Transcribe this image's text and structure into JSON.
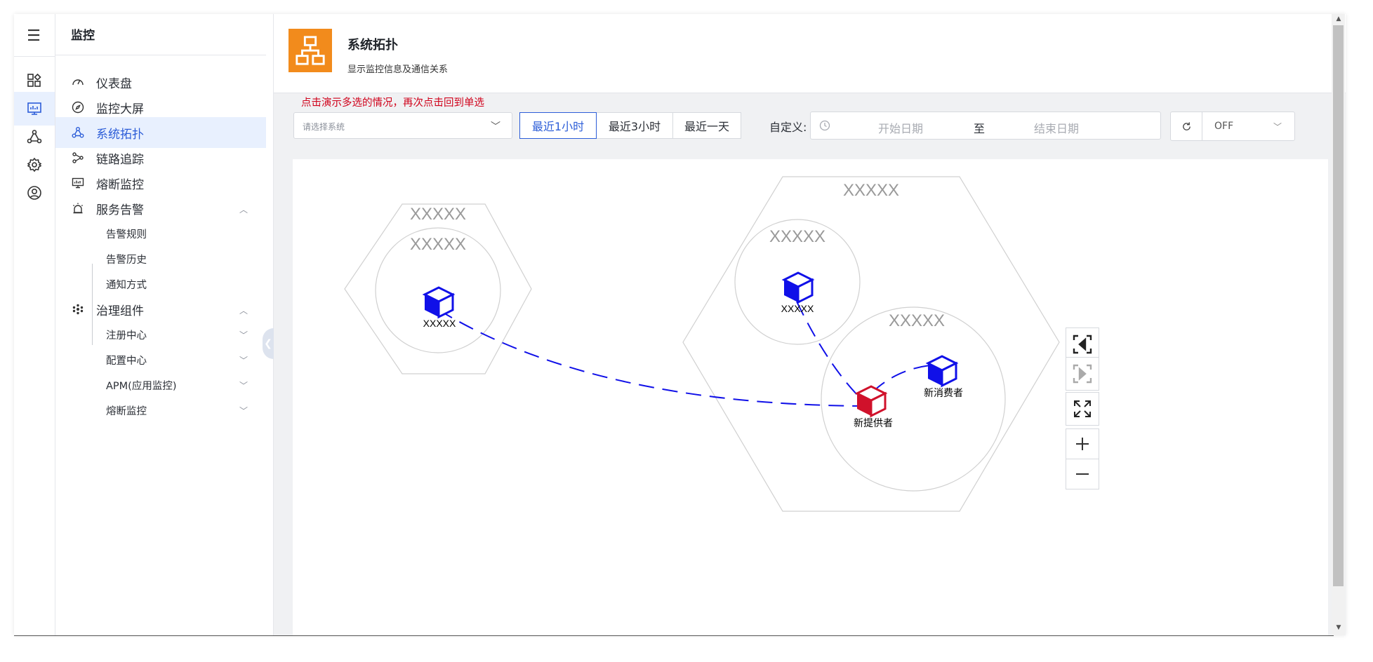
{
  "sidebar": {
    "section_title": "监控",
    "items": [
      {
        "label": "仪表盘",
        "icon": "dashboard-gauge-icon"
      },
      {
        "label": "监控大屏",
        "icon": "compass-icon"
      },
      {
        "label": "系统拓扑",
        "icon": "topology-icon",
        "active": true
      },
      {
        "label": "链路追踪",
        "icon": "trace-link-icon"
      },
      {
        "label": "熔断监控",
        "icon": "monitor-screen-icon"
      },
      {
        "label": "服务告警",
        "icon": "alarm-icon",
        "expanded": true
      },
      {
        "label": "治理组件",
        "icon": "components-cluster-icon",
        "expanded": true
      }
    ],
    "alarm_children": [
      "告警规则",
      "告警历史",
      "通知方式"
    ],
    "governance_children": [
      "注册中心",
      "配置中心",
      "APM(应用监控)",
      "熔断监控"
    ]
  },
  "header": {
    "title": "系统拓扑",
    "subtitle": "显示监控信息及通信关系"
  },
  "toolbar": {
    "hint": "点击演示多选的情况，再次点击回到单选",
    "system_placeholder": "请选择系统",
    "ranges": [
      "最近1小时",
      "最近3小时",
      "最近一天"
    ],
    "active_range": "最近1小时",
    "custom_label": "自定义:",
    "start_placeholder": "开始日期",
    "range_separator": "至",
    "end_placeholder": "结束日期",
    "refresh_value": "OFF"
  },
  "topology": {
    "left_group": {
      "hexagon_label": "XXXXX",
      "circle_label": "XXXXX",
      "node_label": "XXXXX"
    },
    "right_group": {
      "hexagon_label": "XXXXX",
      "upper_circle_label": "XXXXX",
      "upper_node_label": "XXXXX",
      "lower_circle_label": "XXXXX",
      "provider_label": "新提供者",
      "consumer_label": "新消费者"
    },
    "colors": {
      "service": "#1010e8",
      "provider": "#d0112b",
      "outline": "#d0d0d0",
      "label": "#999999"
    }
  },
  "colors": {
    "accent": "#2c5dd8",
    "header_icon_bg": "#f28b1c",
    "hint": "#d0021b",
    "active_bg": "#e8f0fe"
  }
}
